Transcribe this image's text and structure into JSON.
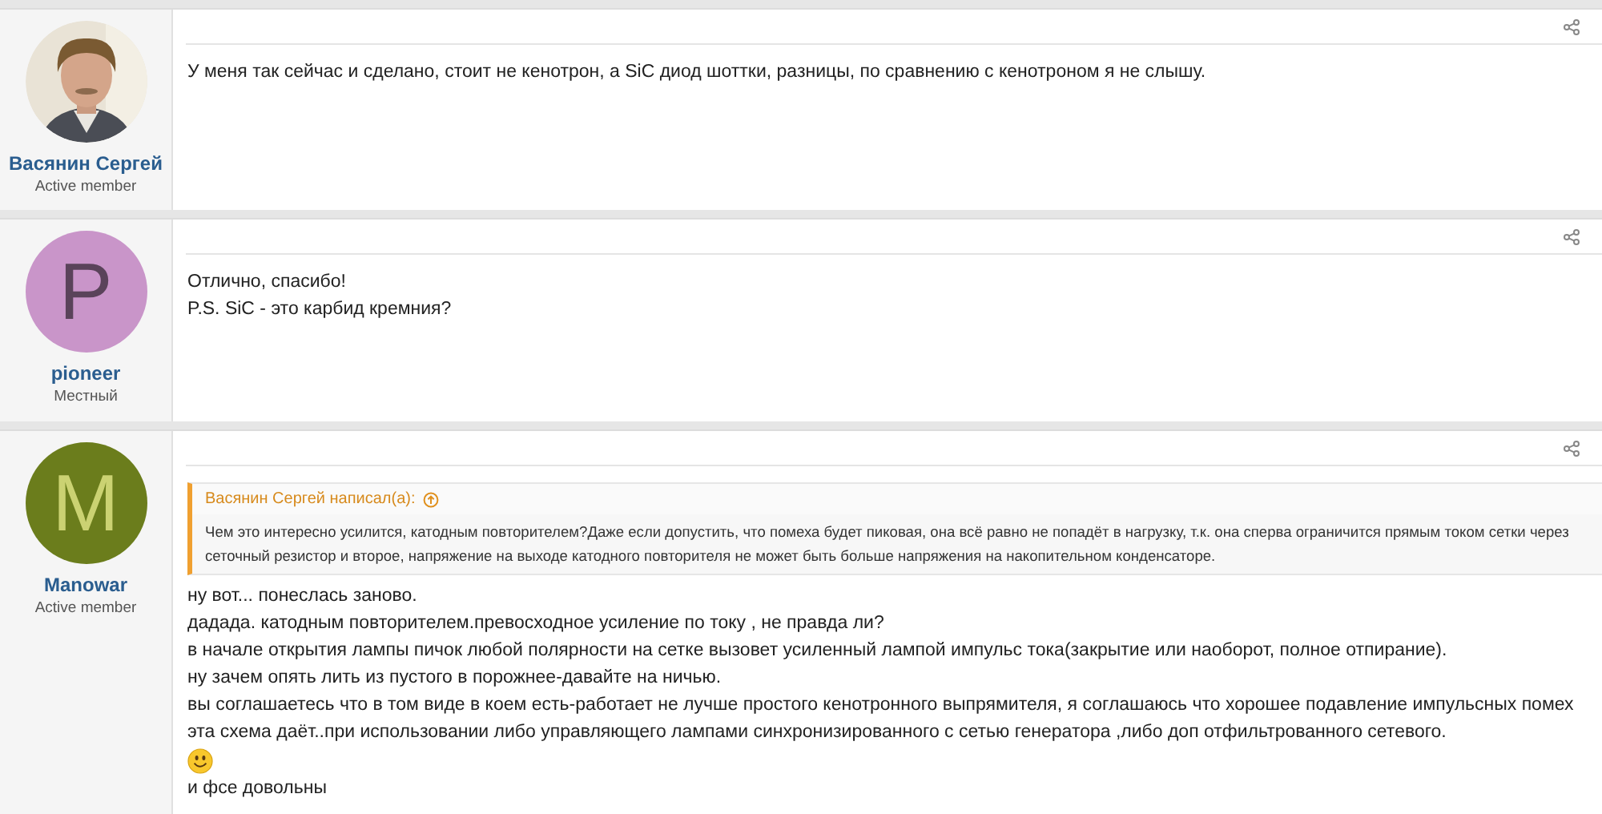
{
  "posts": [
    {
      "author": "Васянин Сергей",
      "user_title": "Active member",
      "avatar": {
        "kind": "picture"
      },
      "blocks": [
        {
          "kind": "text",
          "text": "У меня так сейчас и сделано, стоит не кенотрон, а SiC диод шоттки, разницы, по сравнению с кенотроном я не слышу."
        }
      ]
    },
    {
      "author": "pioneer",
      "user_title": "Местный",
      "avatar": {
        "kind": "letter",
        "letter": "P",
        "color": "#c995c9",
        "light_letter": false
      },
      "blocks": [
        {
          "kind": "text",
          "text": "Отлично, спасибо!"
        },
        {
          "kind": "text",
          "text": "P.S. SiC - это карбид кремния?"
        }
      ]
    },
    {
      "author": "Manowar",
      "user_title": "Active member",
      "avatar": {
        "kind": "letter",
        "letter": "M",
        "color": "#6b7d1c",
        "light_letter": true
      },
      "quote": {
        "title": "Васянин Сергей написал(а):",
        "text": "Чем это интересно усилится, катодным повторителем?Даже если допустить, что помеха будет пиковая, она всё равно не попадёт в нагрузку, т.к. она сперва ограничится прямым током сетки через сеточный резистор и второе, напряжение на выходе катодного повторителя не может быть больше напряжения на накопительном конденсаторе."
      },
      "blocks": [
        {
          "kind": "text",
          "text": "ну вот... понеслась заново."
        },
        {
          "kind": "text",
          "text": "дадада. катодным повторителем.превосходное усиление по току , не правда ли?"
        },
        {
          "kind": "text",
          "text": "в начале открытия лампы пичок любой полярности на сетке вызовет усиленный лампой импульс тока(закрытие или наоборот, полное отпирание)."
        },
        {
          "kind": "text",
          "text": "ну зачем опять лить из пустого в порожнее-давайте на ничью."
        },
        {
          "kind": "text",
          "text": "вы соглашаетесь что в том виде в коем есть-работает не лучше простого кенотронного выпрямителя, я соглашаюсь что хорошее подавление импульсных помех эта схема даёт..при использовании либо управляющего лампами синхронизированного с сетью генератора ,либо доп отфильтрованного сетевого."
        },
        {
          "kind": "emoji"
        },
        {
          "kind": "text",
          "text": "и фсе довольны"
        }
      ]
    }
  ]
}
